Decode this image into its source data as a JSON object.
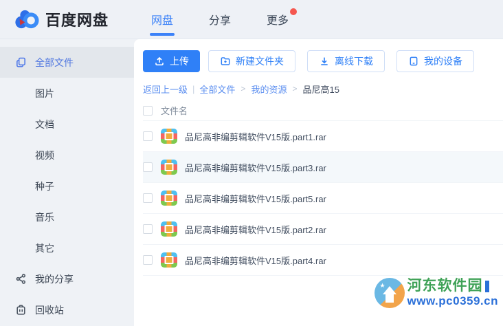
{
  "header": {
    "logo_text": "百度网盘",
    "tabs": [
      {
        "label": "网盘",
        "active": true
      },
      {
        "label": "分享",
        "active": false
      },
      {
        "label": "更多",
        "active": false,
        "has_red_dot": true
      }
    ]
  },
  "sidebar": {
    "items": [
      {
        "label": "全部文件",
        "icon": "all-files-icon",
        "active": true
      },
      {
        "label": "图片"
      },
      {
        "label": "文档"
      },
      {
        "label": "视频"
      },
      {
        "label": "种子"
      },
      {
        "label": "音乐"
      },
      {
        "label": "其它"
      },
      {
        "label": "我的分享",
        "icon": "share-icon"
      },
      {
        "label": "回收站",
        "icon": "trash-icon"
      }
    ]
  },
  "toolbar": {
    "upload_label": "上传",
    "new_folder_label": "新建文件夹",
    "offline_download_label": "离线下载",
    "my_devices_label": "我的设备"
  },
  "breadcrumb": {
    "back_label": "返回上一级",
    "items": [
      "全部文件",
      "我的资源",
      "品尼高15"
    ]
  },
  "file_list": {
    "column_header": "文件名",
    "files": [
      {
        "name": "品尼高非编剪辑软件V15版.part1.rar",
        "type": "rar",
        "highlighted": false
      },
      {
        "name": "品尼高非编剪辑软件V15版.part3.rar",
        "type": "rar",
        "highlighted": true
      },
      {
        "name": "品尼高非编剪辑软件V15版.part5.rar",
        "type": "rar",
        "highlighted": false
      },
      {
        "name": "品尼高非编剪辑软件V15版.part2.rar",
        "type": "rar",
        "highlighted": false
      },
      {
        "name": "品尼高非编剪辑软件V15版.part4.rar",
        "type": "rar",
        "highlighted": false
      }
    ]
  },
  "watermark": {
    "site_name": "河东软件园",
    "site_url": "www.pc0359.cn"
  },
  "colors": {
    "primary_blue": "#2f80f7",
    "tab_active_blue": "#3c82f8",
    "sidebar_active_blue": "#5379e0",
    "badge_red": "#f5574f",
    "watermark_green": "#3fa257",
    "watermark_blue": "#2a6fd8",
    "rar_icon_blue": "#4fc0f0",
    "rar_icon_red": "#f56560",
    "rar_icon_green": "#7ec94f",
    "rar_icon_yellow": "#f0ad3c"
  }
}
